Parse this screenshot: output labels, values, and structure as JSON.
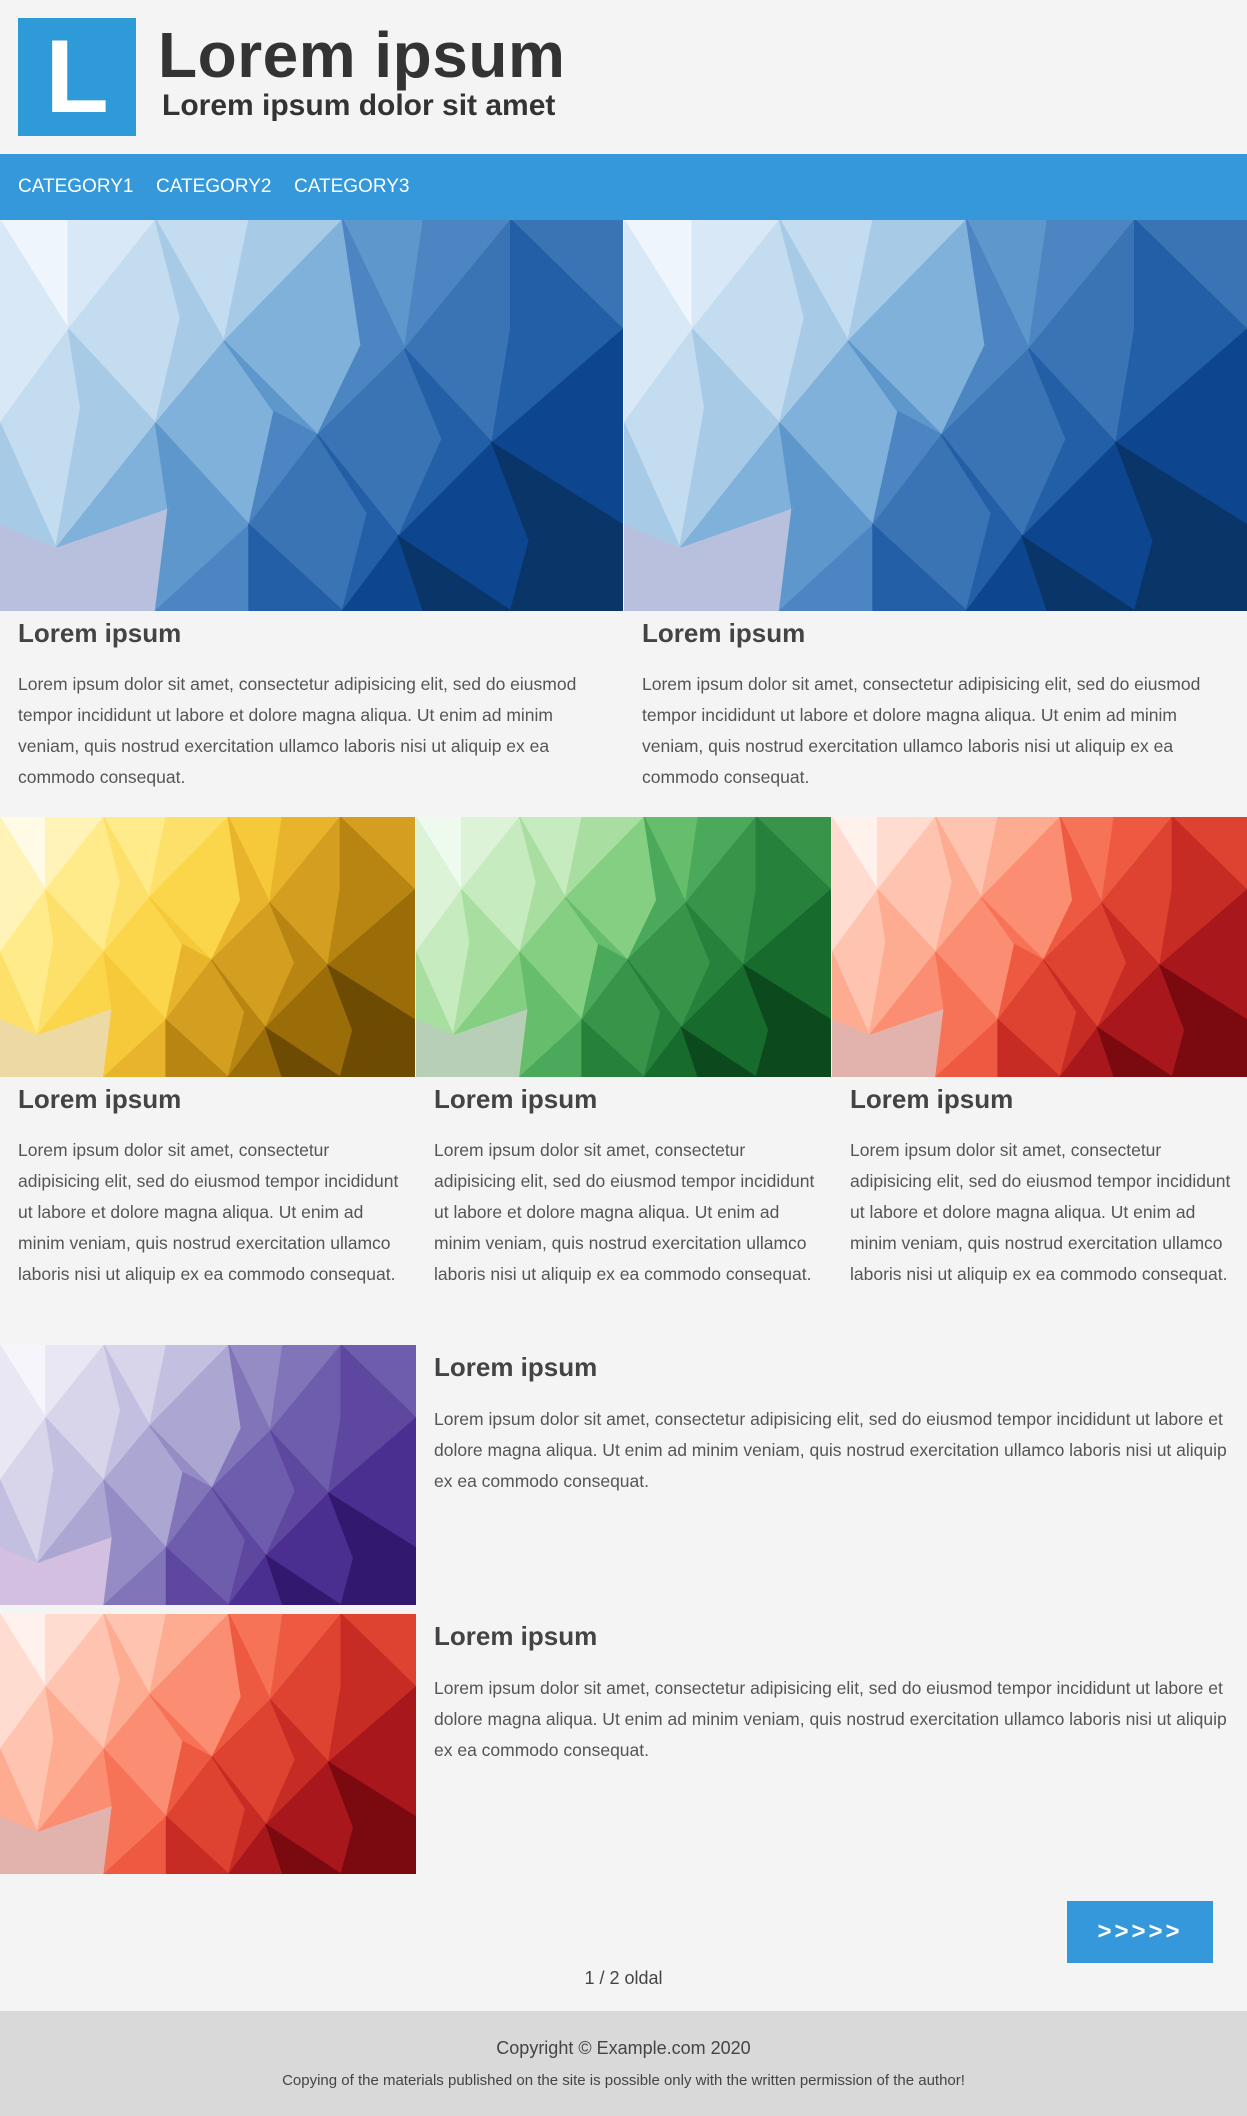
{
  "logo": {
    "letter": "L"
  },
  "header": {
    "title": "Lorem ipsum",
    "subtitle": "Lorem ipsum dolor sit amet"
  },
  "nav": {
    "items": [
      "CATEGORY1",
      "CATEGORY2",
      "CATEGORY3"
    ]
  },
  "colors": {
    "brand_blue": "#3498db",
    "background": "#f4f4f4",
    "footer_background": "#d9d9d9"
  },
  "articles": [
    {
      "title": "Lorem ipsum",
      "text": "Lorem ipsum dolor sit amet, consectetur adipisicing elit, sed do eiusmod tempor incididunt ut labore et dolore magna aliqua. Ut enim ad minim veniam, quis nostrud exercitation ullamco laboris nisi ut aliquip ex ea commodo consequat.",
      "palette": "blue"
    },
    {
      "title": "Lorem ipsum",
      "text": "Lorem ipsum dolor sit amet, consectetur adipisicing elit, sed do eiusmod tempor incididunt ut labore et dolore magna aliqua. Ut enim ad minim veniam, quis nostrud exercitation ullamco laboris nisi ut aliquip ex ea commodo consequat.",
      "palette": "blue"
    },
    {
      "title": "Lorem ipsum",
      "text": "Lorem ipsum dolor sit amet, consectetur adipisicing elit, sed do eiusmod tempor incididunt ut labore et dolore magna aliqua. Ut enim ad minim veniam, quis nostrud exercitation ullamco laboris nisi ut aliquip ex ea commodo consequat.",
      "palette": "yellow"
    },
    {
      "title": "Lorem ipsum",
      "text": "Lorem ipsum dolor sit amet, consectetur adipisicing elit, sed do eiusmod tempor incididunt ut labore et dolore magna aliqua. Ut enim ad minim veniam, quis nostrud exercitation ullamco laboris nisi ut aliquip ex ea commodo consequat.",
      "palette": "green"
    },
    {
      "title": "Lorem ipsum",
      "text": "Lorem ipsum dolor sit amet, consectetur adipisicing elit, sed do eiusmod tempor incididunt ut labore et dolore magna aliqua. Ut enim ad minim veniam, quis nostrud exercitation ullamco laboris nisi ut aliquip ex ea commodo consequat.",
      "palette": "red"
    },
    {
      "title": "Lorem ipsum",
      "text": "Lorem ipsum dolor sit amet, consectetur adipisicing elit, sed do eiusmod tempor incididunt ut labore et dolore magna aliqua. Ut enim ad minim veniam, quis nostrud exercitation ullamco laboris nisi ut aliquip ex ea commodo consequat.",
      "palette": "purple"
    },
    {
      "title": "Lorem ipsum",
      "text": "Lorem ipsum dolor sit amet, consectetur adipisicing elit, sed do eiusmod tempor incididunt ut labore et dolore magna aliqua. Ut enim ad minim veniam, quis nostrud exercitation ullamco laboris nisi ut aliquip ex ea commodo consequat.",
      "palette": "red"
    }
  ],
  "palettes": {
    "blue": [
      "#eef5fc",
      "#d9e8f6",
      "#c3dcef",
      "#a7cbe6",
      "#7fb1da",
      "#5e97cb",
      "#4d84c2",
      "#3b74b4",
      "#235fa6",
      "#0d468f",
      "#0a3569",
      "#b9c0de"
    ],
    "yellow": [
      "#fffbe6",
      "#fff3b8",
      "#ffeb8a",
      "#fde06a",
      "#fbd54a",
      "#f6c93a",
      "#e8b42c",
      "#d49e20",
      "#b88512",
      "#9a6d08",
      "#6e4b03",
      "#ecd9a4"
    ],
    "green": [
      "#effaee",
      "#dcf3d8",
      "#c5ebbe",
      "#a8dfa1",
      "#85cf83",
      "#66bd6c",
      "#4aa95a",
      "#379449",
      "#26813b",
      "#176b2d",
      "#0c4a1d",
      "#b7ceb7"
    ],
    "red": [
      "#fff1ec",
      "#ffdccf",
      "#ffc4b0",
      "#fdab91",
      "#fb8e72",
      "#f77357",
      "#ee5a41",
      "#dd4330",
      "#c62c24",
      "#a8171b",
      "#7a0a10",
      "#e2b3ad"
    ],
    "purple": [
      "#f6f5fb",
      "#e9e7f4",
      "#d8d5eb",
      "#c3bfe0",
      "#aca6d3",
      "#958cc5",
      "#8174b8",
      "#6e5dac",
      "#5e479f",
      "#4a2f90",
      "#33186f",
      "#d3bfe0"
    ]
  },
  "pagination": {
    "next_label": ">>>>>",
    "page_indicator": "1 / 2 oldal"
  },
  "footer": {
    "copyright": "Copyright © Example.com 2020",
    "notice": "Copying of the materials published on the site is possible only with the written permission of the author!"
  }
}
